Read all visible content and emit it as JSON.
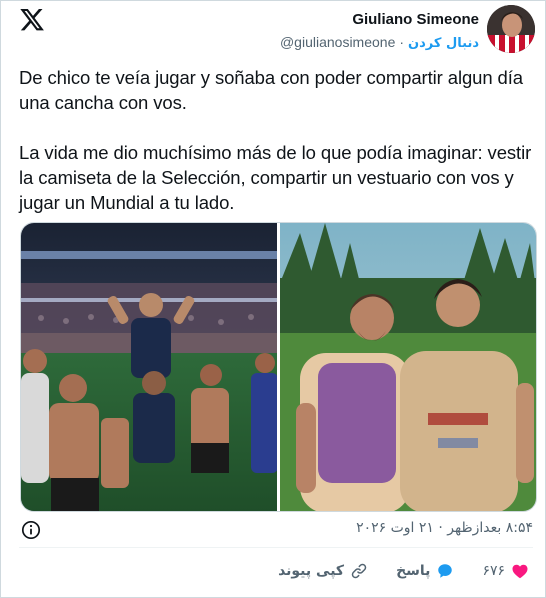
{
  "header": {
    "display_name": "Giuliano Simeone",
    "handle": "@giulianosimeone",
    "separator": "·",
    "follow_label": "دنبال کردن"
  },
  "tweet": {
    "paragraphs": [
      "De chico te veía jugar y soñaba con poder compartir algun día una cancha con vos.",
      "La vida me dio muchísimo más de lo que podía imaginar: vestir la camiseta de la Selección, compartir un vestuario con vos y jugar un Mundial a tu lado."
    ]
  },
  "media": {
    "photos": [
      {
        "icon": "photo-celebration"
      },
      {
        "icon": "photo-two-players"
      }
    ]
  },
  "footer": {
    "timestamp": "۸:۵۴ بعدازظهر · ۲۱ اوت ۲۰۲۶",
    "likes_count": "۶۷۶",
    "reply_label": "پاسخ",
    "copy_link_label": "کپی پیوند"
  },
  "colors": {
    "accent": "#1d9bf0",
    "like": "#f91880",
    "secondary_text": "#536471"
  }
}
